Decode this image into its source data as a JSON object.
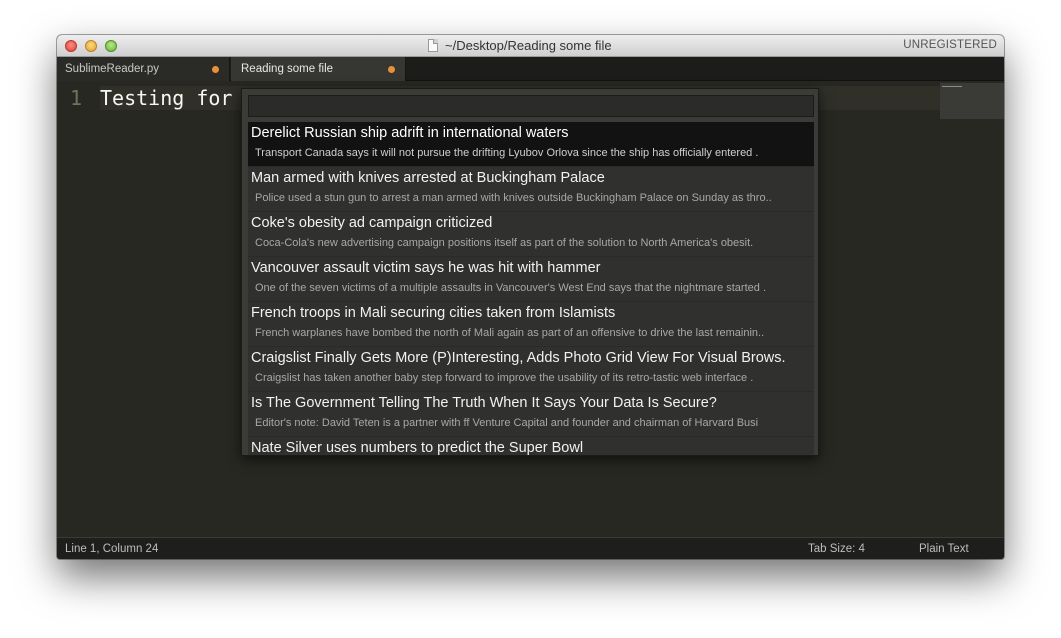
{
  "window": {
    "title": "~/Desktop/Reading some file",
    "registration_label": "UNREGISTERED"
  },
  "tabs": [
    {
      "label": "SublimeReader.py",
      "modified": true,
      "active": false
    },
    {
      "label": "Reading some file",
      "modified": true,
      "active": true
    }
  ],
  "editor": {
    "line_number": "1",
    "line_text": "Testing for"
  },
  "palette": {
    "query": "",
    "results": [
      {
        "title": "Derelict Russian ship adrift in international waters",
        "description": "Transport Canada says it will not pursue the drifting Lyubov Orlova since the ship has officially entered ."
      },
      {
        "title": "Man armed with knives arrested at Buckingham Palace",
        "description": "Police used a stun gun to arrest a man armed with knives outside Buckingham Palace on Sunday as thro.."
      },
      {
        "title": "Coke's obesity ad campaign criticized",
        "description": "Coca-Cola's new advertising campaign positions itself as part of the solution to North America's obesit."
      },
      {
        "title": "Vancouver assault victim says he was hit with hammer",
        "description": "One of the seven victims of a multiple assaults in Vancouver's West End says that the nightmare started ."
      },
      {
        "title": "French troops in Mali securing cities taken from Islamists",
        "description": "French warplanes have bombed the north of Mali again as part of an offensive to drive the last remainin.."
      },
      {
        "title": "Craigslist Finally Gets More (P)Interesting, Adds Photo Grid View For Visual Brows.",
        "description": "Craigslist has taken another baby step forward to improve the usability of its retro-tastic web interface ."
      },
      {
        "title": "Is The Government Telling The Truth When It Says Your Data Is Secure?",
        "description": " Editor's note: David Teten is a partner with ff Venture Capital and founder and chairman of Harvard Busi"
      },
      {
        "title": "Nate Silver uses numbers to predict the Super Bowl",
        "description": ""
      }
    ]
  },
  "status": {
    "position": "Line 1, Column 24",
    "tab_size": "Tab Size: 4",
    "syntax": "Plain Text"
  },
  "colors": {
    "editor_bg": "#272822",
    "modified_dot": "#e8913c",
    "selected_row": "#121212"
  }
}
